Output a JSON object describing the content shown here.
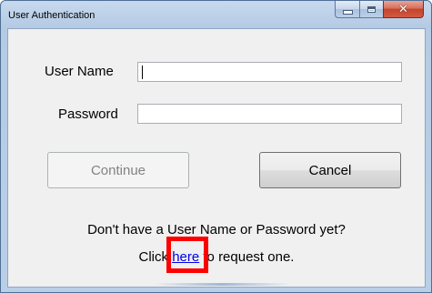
{
  "window": {
    "title": "User Authentication",
    "caption_buttons": {
      "minimize_icon": "minimize-icon",
      "maximize_icon": "maximize-icon",
      "close_icon": "close-icon",
      "close_glyph": "✕"
    }
  },
  "form": {
    "username_label": "User Name",
    "username_value": "",
    "password_label": "Password",
    "password_value": ""
  },
  "buttons": {
    "continue_label": "Continue",
    "cancel_label": "Cancel"
  },
  "info": {
    "line1": "Don't have a User Name or Password yet?",
    "line2_prefix": "Click ",
    "link_text": "here",
    "line2_suffix": " to request one."
  },
  "colors": {
    "highlight": "#ff0000",
    "link": "#0000ee",
    "disabled_text": "#838383"
  }
}
